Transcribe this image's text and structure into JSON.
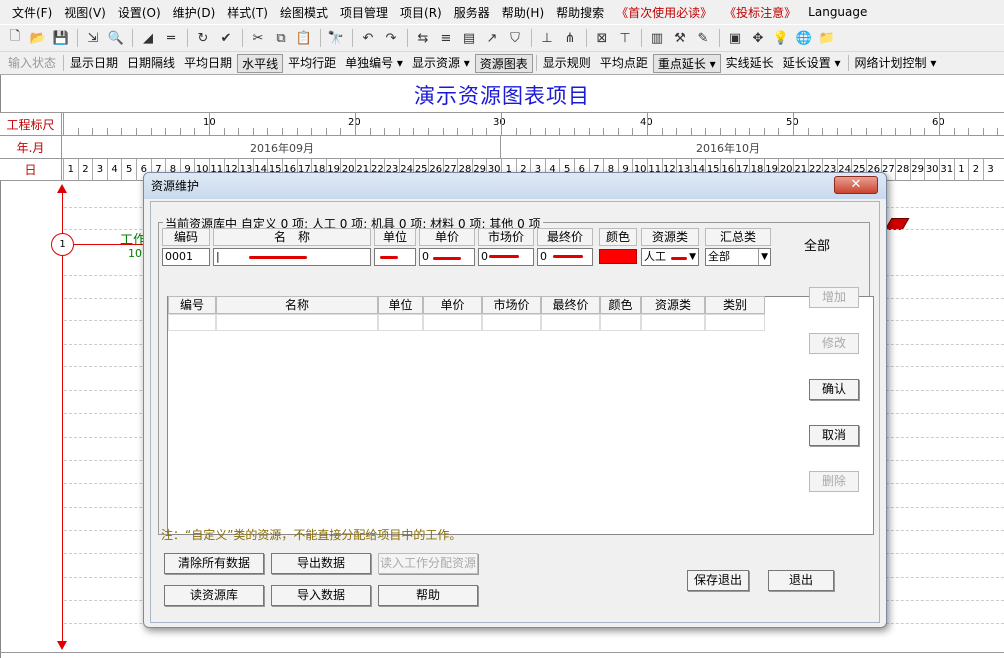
{
  "menubar": [
    {
      "label": "文件(F)",
      "red": false
    },
    {
      "label": "视图(V)",
      "red": false
    },
    {
      "label": "设置(O)",
      "red": false
    },
    {
      "label": "维护(D)",
      "red": false
    },
    {
      "label": "样式(T)",
      "red": false
    },
    {
      "label": "绘图模式",
      "red": false
    },
    {
      "label": "项目管理",
      "red": false
    },
    {
      "label": "项目(R)",
      "red": false
    },
    {
      "label": "服务器",
      "red": false
    },
    {
      "label": "帮助(H)",
      "red": false
    },
    {
      "label": "帮助搜索",
      "red": false
    },
    {
      "label": "《首次使用必读》",
      "red": true
    },
    {
      "label": "《投标注意》",
      "red": true
    },
    {
      "label": "Language",
      "red": false
    }
  ],
  "toolbar_icons": [
    "new-icon",
    "open-icon",
    "save-icon",
    "sep",
    "export-icon",
    "print-preview-icon",
    "sep",
    "line-style-icon",
    "line-icon",
    "sep",
    "refresh-icon",
    "check-icon",
    "sep",
    "cut-icon",
    "copy-icon",
    "paste-icon",
    "sep",
    "find-icon",
    "sep",
    "undo-icon",
    "redo-icon",
    "sep",
    "link-icon",
    "gantt-icon",
    "bar-icon",
    "curve-icon",
    "resource-icon",
    "sep",
    "align-icon",
    "distribute-icon",
    "sep",
    "network-icon",
    "level-icon",
    "sep",
    "chart-icon",
    "tool-icon",
    "edit-icon",
    "sep",
    "window-icon",
    "pin-icon",
    "bulb-icon",
    "globe-icon",
    "folder-icon"
  ],
  "toolbar_glyphs": {
    "new-icon": "🗋",
    "open-icon": "📂",
    "save-icon": "💾",
    "export-icon": "⇲",
    "print-preview-icon": "🔍",
    "line-style-icon": "◢",
    "line-icon": "═",
    "refresh-icon": "↻",
    "check-icon": "✔",
    "cut-icon": "✂",
    "copy-icon": "⧉",
    "paste-icon": "📋",
    "find-icon": "🔭",
    "undo-icon": "↶",
    "redo-icon": "↷",
    "link-icon": "⇆",
    "gantt-icon": "≡",
    "bar-icon": "▤",
    "curve-icon": "↗",
    "resource-icon": "⛉",
    "align-icon": "⊥",
    "distribute-icon": "⋔",
    "network-icon": "⊠",
    "level-icon": "⊤",
    "chart-icon": "▥",
    "tool-icon": "⚒",
    "edit-icon": "✎",
    "window-icon": "▣",
    "pin-icon": "✥",
    "bulb-icon": "💡",
    "globe-icon": "🌐",
    "folder-icon": "📁"
  },
  "toolbar2": [
    {
      "label": "输入状态",
      "disabled": true,
      "pressed": false
    },
    {
      "label": "sep"
    },
    {
      "label": "显示日期",
      "disabled": false,
      "pressed": false
    },
    {
      "label": "日期隔线",
      "disabled": false,
      "pressed": false
    },
    {
      "label": "平均日期",
      "disabled": false,
      "pressed": false
    },
    {
      "label": "水平线",
      "disabled": false,
      "pressed": true
    },
    {
      "label": "平均行距",
      "disabled": false,
      "pressed": false
    },
    {
      "label": "单独编号 ▾",
      "disabled": false,
      "pressed": false
    },
    {
      "label": "显示资源 ▾",
      "disabled": false,
      "pressed": false
    },
    {
      "label": "资源图表",
      "disabled": false,
      "pressed": true
    },
    {
      "label": "sep"
    },
    {
      "label": "显示规则",
      "disabled": false,
      "pressed": false
    },
    {
      "label": "平均点距",
      "disabled": false,
      "pressed": false
    },
    {
      "label": "重点延长 ▾",
      "disabled": false,
      "pressed": true
    },
    {
      "label": "实线延长",
      "disabled": false,
      "pressed": false
    },
    {
      "label": "延长设置 ▾",
      "disabled": false,
      "pressed": false
    },
    {
      "label": "sep"
    },
    {
      "label": "网络计划控制 ▾",
      "disabled": false,
      "pressed": false
    }
  ],
  "chart": {
    "title": "演示资源图表项目",
    "ruler_label": "工程标尺",
    "yearmonth_label": "年.月",
    "day_label": "日",
    "ruler_ticks": [
      "10",
      "20",
      "30",
      "40",
      "50",
      "60"
    ],
    "months": [
      "2016年09月",
      "2016年10月"
    ],
    "days": [
      "1",
      "2",
      "3",
      "4",
      "5",
      "6",
      "7",
      "8",
      "9",
      "10",
      "11",
      "12",
      "13",
      "14",
      "15",
      "16",
      "17",
      "18",
      "19",
      "20",
      "21",
      "22",
      "23",
      "24",
      "25",
      "26",
      "27",
      "28",
      "29",
      "30",
      "1",
      "2",
      "3",
      "4",
      "5",
      "6",
      "7",
      "8",
      "9",
      "10",
      "11",
      "12",
      "13",
      "14",
      "15",
      "16",
      "17",
      "18",
      "19",
      "20",
      "21",
      "22",
      "23",
      "24",
      "25",
      "26",
      "27",
      "28",
      "29",
      "30",
      "31",
      "1",
      "2",
      "3"
    ],
    "node_label": "1",
    "work_label": "工作",
    "work_num": "10"
  },
  "dialog": {
    "title": "资源维护",
    "close": "✕",
    "group_label": "当前资源库中 自定义 0 项; 人工 0 项; 机具 0 项; 材料 0 项; 其他 0 项",
    "input_headers": [
      "编码",
      "名　称",
      "单位",
      "单价",
      "市场价",
      "最终价",
      "颜色",
      "资源类",
      "汇总类"
    ],
    "input_values": {
      "code": "0001",
      "name": "|",
      "unit": "",
      "price": "0",
      "market": "0",
      "final": "0",
      "res_type": "人工",
      "summary": "全部"
    },
    "table_headers": [
      "编号",
      "名称",
      "单位",
      "单价",
      "市场价",
      "最终价",
      "颜色",
      "资源类",
      "类别"
    ],
    "filter_label": "全部",
    "side_buttons": [
      {
        "label": "增加",
        "disabled": true
      },
      {
        "label": "修改",
        "disabled": true
      },
      {
        "label": "确认",
        "disabled": false
      },
      {
        "label": "取消",
        "disabled": false
      },
      {
        "label": "删除",
        "disabled": true
      }
    ],
    "note": "注：“自定义”类的资源，不能直接分配给项目中的工作。",
    "bottom_buttons": [
      {
        "label": "清除所有数据",
        "disabled": false
      },
      {
        "label": "导出数据",
        "disabled": false
      },
      {
        "label": "读入工作分配资源",
        "disabled": true
      },
      {
        "label": "读资源库",
        "disabled": false
      },
      {
        "label": "导入数据",
        "disabled": false
      },
      {
        "label": "帮助",
        "disabled": false
      },
      {
        "label": "保存退出",
        "disabled": false
      },
      {
        "label": "退出",
        "disabled": false
      }
    ],
    "color_swatch": "#ff0000"
  }
}
